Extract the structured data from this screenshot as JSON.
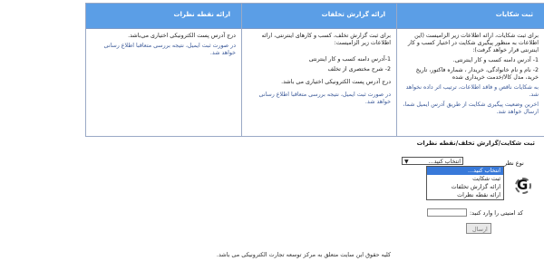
{
  "columns": [
    {
      "id": "complaint",
      "header": "ثبت شکایات",
      "body": [
        "برای ثبت شکایات، ارائه اطلاعات زیر الزامیست (این اطلاعات به منظور پیگیری شکایت در اختیار کسب و کار اینترنتی قرار خواهد گرفت):",
        "1- آدرس دامنه کسب و کار اینترنتی.",
        "2- نام و نام خانوادگی، خریدار ، شماره فاکتور، تاریخ خرید، مدل کالا/خدمت خریداری شده",
        "به شکایات ناقص و فاقد اطلاعات، ترتیب اثر داده نخواهد شد.",
        "اخرین وضعیت پیگیری شکایت از طریق آدرس ایمیل شما، ارسال خواهد شد."
      ]
    },
    {
      "id": "violation",
      "header": "ارائه گزارش تخلفات",
      "body": [
        "برای ثبت گزارش تخلف، کسب و کارهای اینترنتی، ارائه اطلاعات زیر الزامیست:",
        "1-آدرس دامنه کسب و کار اینترنتی",
        "2- شرح مختصری از تخلف",
        "درج آدرس پست الکترونیکی اختیاری می باشد.",
        "در صورت ثبت ایمیل، نتیجه بررسی متعاقبا اطلاع رسانی خواهد شد."
      ]
    },
    {
      "id": "opinion",
      "header": "ارائه نقطه نظرات",
      "body": [
        "درج آدرس پست الکترونیکی اختیاری می‌باشد.",
        "در صورت ثبت ایمیل، نتیجه بررسی متعاقبا اطلاع رسانی خواهد شد."
      ]
    }
  ],
  "form": {
    "title": "ثبت شکایت/گزارش تخلف/نقطه نظرات",
    "type_label": "نوع نظر",
    "select_value": "انتخاب کنید...",
    "options": [
      "انتخاب کنید...",
      "ثبت شکایت",
      "ارائه گزارش تخلفات",
      "ارائه نقطه نظرات"
    ],
    "captcha_text": "G",
    "captcha_label": "کد امنیتی را وارد کنید:",
    "submit_label": "ارسال"
  },
  "footer": "کلیه حقوق این سایت متعلق به مرکز توسعه تجارت الکترونیکی می باشد.",
  "colors": {
    "header_bg": "#5b9ee6",
    "selected_option": "#3879d9",
    "link": "#3b5998"
  }
}
